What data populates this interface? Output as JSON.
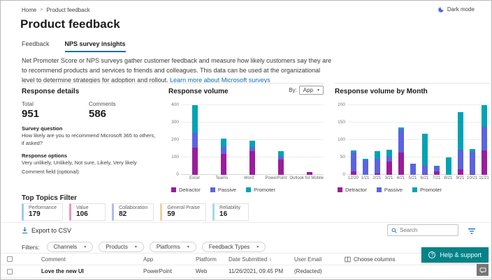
{
  "header": {
    "breadcrumb": {
      "home": "Home",
      "current": "Product feedback"
    },
    "dark_mode_label": "Dark mode",
    "title": "Product feedback"
  },
  "tabs": [
    {
      "label": "Feedback",
      "active": false
    },
    {
      "label": "NPS survey insights",
      "active": true
    }
  ],
  "description": {
    "text": "Net Promoter Score or NPS surveys gather customer feedback and measure how likely customers say they are to recommend products and services to friends and colleagues. This data can be used at the organizational level to determine strategies for adoption and rollout.",
    "link": "Learn more about Microsoft surveys"
  },
  "response_details": {
    "title": "Response details",
    "total_label": "Total",
    "total": "951",
    "comments_label": "Comments",
    "comments": "586",
    "survey_question_label": "Survey question",
    "survey_question": "How likely are you to recommend Microsoft 365 to others, if asked?",
    "response_options_label": "Response options",
    "response_options_line1": "Very unlikely, Unlikely, Not sure, Likely, Very likely",
    "response_options_line2": "Comment field (optional)"
  },
  "volume_chart": {
    "title": "Response volume",
    "by_label": "By:",
    "by_value": "App"
  },
  "month_chart": {
    "title": "Response volume by Month"
  },
  "chart_data": [
    {
      "type": "bar",
      "stacked": true,
      "title": "Response volume",
      "categories": [
        "Excel",
        "Teams",
        "Word",
        "PowerPoint",
        "Outlook for Mobile"
      ],
      "series": [
        {
          "name": "Detractor",
          "color": "#9a1d9b",
          "values": [
            155,
            120,
            135,
            90,
            15
          ]
        },
        {
          "name": "Passive",
          "color": "#5a64e0",
          "values": [
            85,
            42,
            25,
            20,
            0
          ]
        },
        {
          "name": "Promoter",
          "color": "#00a3b5",
          "values": [
            160,
            48,
            35,
            28,
            0
          ]
        }
      ],
      "ylim": [
        0,
        400
      ],
      "yticks": [
        0,
        100,
        200,
        300,
        400
      ],
      "legend_position": "bottom",
      "grid": true
    },
    {
      "type": "bar",
      "stacked": true,
      "title": "Response volume by Month",
      "categories": [
        "12/20",
        "1/21",
        "2/21",
        "3/21",
        "4/21",
        "5/21",
        "6/21",
        "7/21",
        "8/21",
        "9/21",
        "10/21",
        "11/21"
      ],
      "series": [
        {
          "name": "Detractor",
          "color": "#9a1d9b",
          "values": [
            10,
            0,
            5,
            39,
            65,
            0,
            3,
            10,
            0,
            16,
            2,
            70
          ]
        },
        {
          "name": "Passive",
          "color": "#5a64e0",
          "values": [
            55,
            42,
            42,
            15,
            65,
            32,
            26,
            14,
            0,
            57,
            64,
            68
          ]
        },
        {
          "name": "Promoter",
          "color": "#00a3b5",
          "values": [
            5,
            4,
            21,
            19,
            7,
            0,
            89,
            2,
            51,
            108,
            9,
            62
          ]
        }
      ],
      "ylim": [
        0,
        200
      ],
      "yticks": [
        0,
        50,
        100,
        150,
        200
      ],
      "legend_position": "bottom",
      "grid": true
    }
  ],
  "topics": {
    "title": "Top Topics Filter",
    "items": [
      {
        "label": "Performance",
        "value": "179",
        "color": "#9ecbee"
      },
      {
        "label": "Value",
        "value": "106",
        "color": "#f191bf"
      },
      {
        "label": "Collaboration",
        "value": "82",
        "color": "#aebdf0"
      },
      {
        "label": "General Praise",
        "value": "59",
        "color": "#ecd2a1"
      },
      {
        "label": "Reliability",
        "value": "16",
        "color": "#a5d9e8"
      }
    ]
  },
  "toolbar": {
    "export_label": "Export to CSV",
    "search_placeholder": "Search",
    "filters_label": "Filters:",
    "filters": [
      "Channels",
      "Products",
      "Platforms",
      "Feedback Types"
    ]
  },
  "table": {
    "headers": [
      "Comment",
      "App",
      "Platform",
      "Date Submitted",
      "User Email"
    ],
    "sorted_column": "Date Submitted",
    "choose_columns_label": "Choose columns",
    "rows": [
      {
        "comment": "Love the new UI",
        "app": "PowerPoint",
        "platform": "Web",
        "date_submitted": "11/26/2021, 09:45 PM",
        "user_email": "(Redacted)"
      }
    ]
  },
  "floating": {
    "help_label": "Help & support"
  },
  "colors": {
    "accent_blue": "#0f6cbd",
    "help_teal": "#038387",
    "detractor": "#9a1d9b",
    "passive": "#5a64e0",
    "promoter": "#00a3b5"
  }
}
